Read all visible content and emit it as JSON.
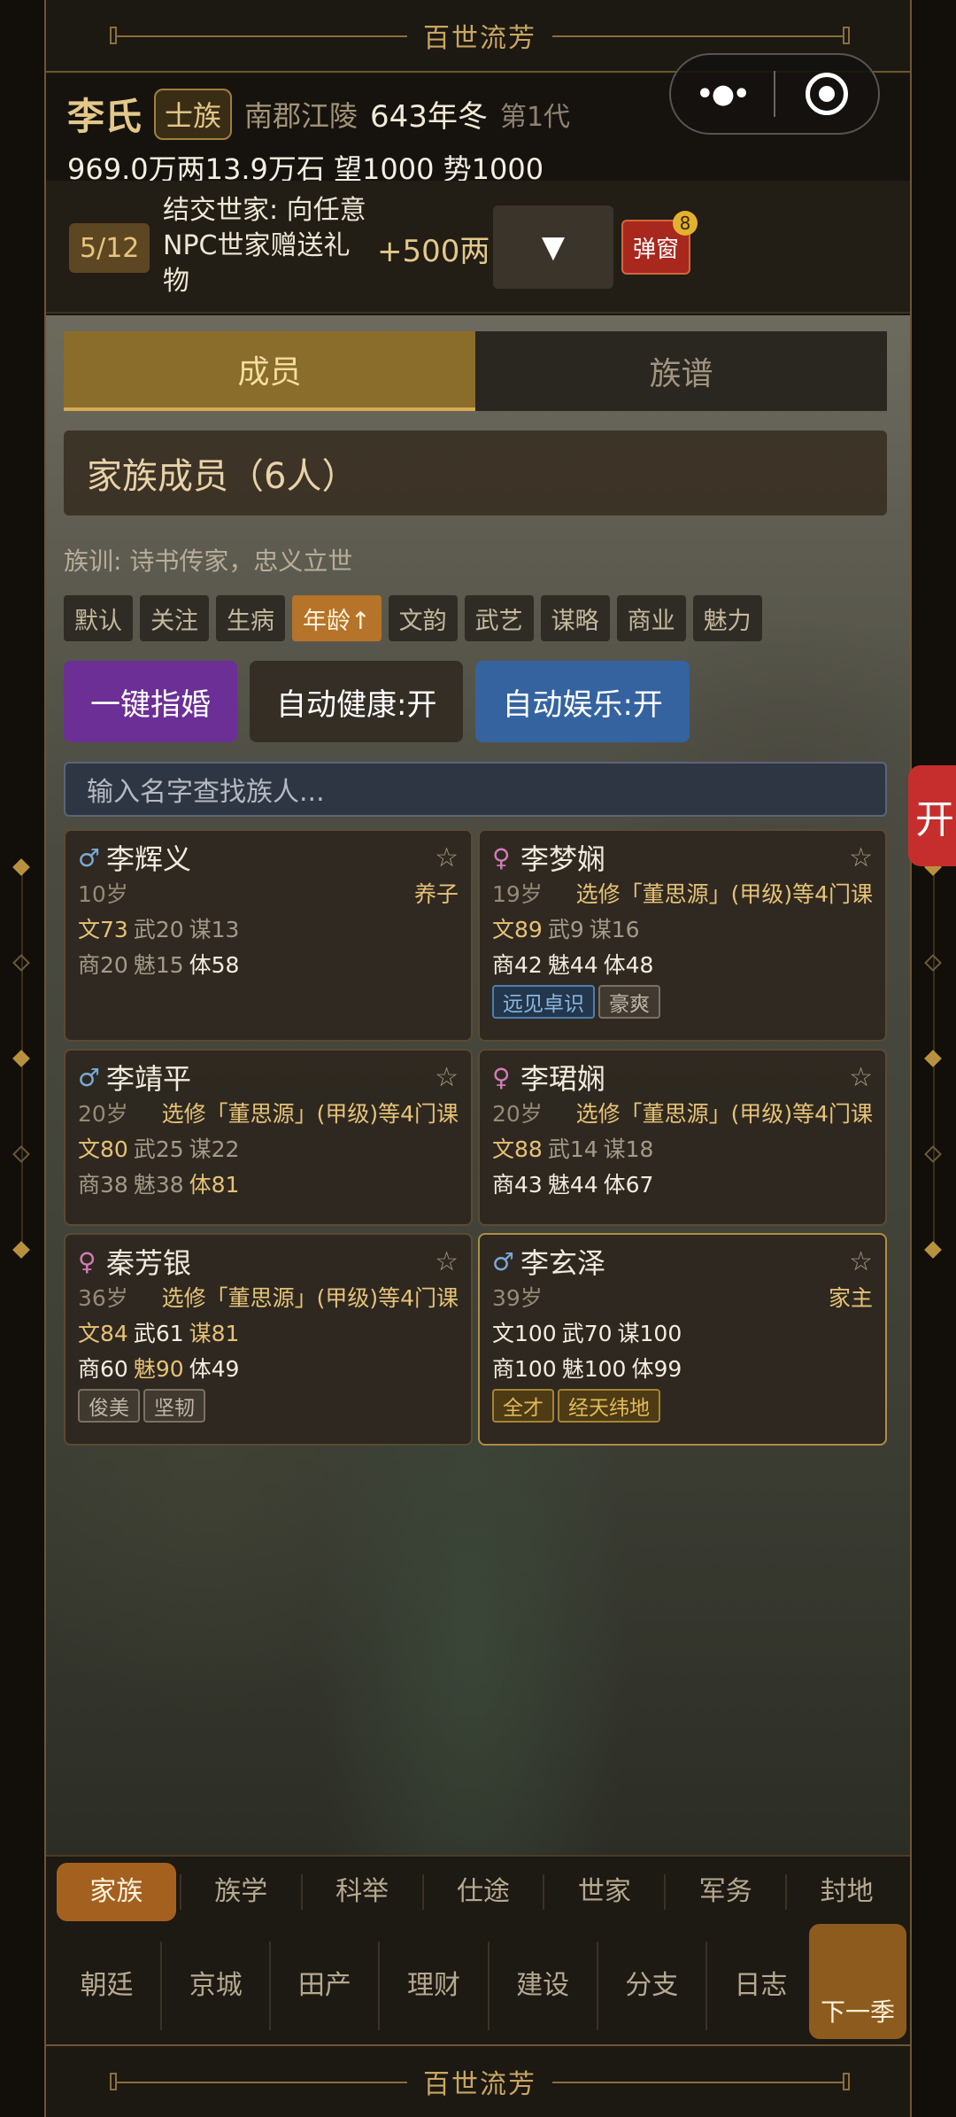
{
  "banner": {
    "title": "百世流芳"
  },
  "header": {
    "family": "李氏",
    "rank": "士族",
    "place": "南郡江陵",
    "year": "643年冬",
    "generation": "第1代",
    "stats": "969.0万两13.9万石  望1000 势1000"
  },
  "capsule": {
    "menu_icon": "more-dots-icon",
    "close_icon": "target-icon"
  },
  "task": {
    "progress": "5/12",
    "desc": "结交世家: 向任意NPC世家赠送礼物",
    "reward": "+500两",
    "dropdown": "▼",
    "popup_label": "弹窗",
    "popup_badge": "8"
  },
  "tabs": [
    {
      "label": "成员"
    },
    {
      "label": "族谱"
    }
  ],
  "section": {
    "title": "家族成员（6人）",
    "motto": "族训: 诗书传家，忠义立世"
  },
  "sorts": [
    "默认",
    "关注",
    "生病",
    "年龄↑",
    "文韵",
    "武艺",
    "谋略",
    "商业",
    "魅力"
  ],
  "actions": [
    "一键指婚",
    "自动健康:开",
    "自动娱乐:开"
  ],
  "search": {
    "placeholder": "输入名字查找族人..."
  },
  "members": [
    {
      "sex": "♂",
      "name": "李辉义",
      "star": "☆",
      "age": "10岁",
      "note": "养子",
      "wen": "文73",
      "wu": "武20",
      "mou": "谋13",
      "shang": "商20",
      "mei": "魅15",
      "ti": "体58",
      "traits": []
    },
    {
      "sex": "♀",
      "name": "李梦娴",
      "star": "☆",
      "age": "19岁",
      "note": "选修「董思源」(甲级)等4门课",
      "wen": "文89",
      "wu": "武9",
      "mou": "谋16",
      "shang": "商42",
      "mei": "魅44",
      "ti": "体48",
      "traits": [
        "远见卓识",
        "豪爽"
      ]
    },
    {
      "sex": "♂",
      "name": "李靖平",
      "star": "☆",
      "age": "20岁",
      "note": "选修「董思源」(甲级)等4门课",
      "wen": "文80",
      "wu": "武25",
      "mou": "谋22",
      "shang": "商38",
      "mei": "魅38",
      "ti": "体81",
      "traits": []
    },
    {
      "sex": "♀",
      "name": "李珺娴",
      "star": "☆",
      "age": "20岁",
      "note": "选修「董思源」(甲级)等4门课",
      "wen": "文88",
      "wu": "武14",
      "mou": "谋18",
      "shang": "商43",
      "mei": "魅44",
      "ti": "体67",
      "traits": []
    },
    {
      "sex": "♀",
      "name": "秦芳银",
      "star": "☆",
      "age": "36岁",
      "note": "选修「董思源」(甲级)等4门课",
      "wen": "文84",
      "wu": "武61",
      "mou": "谋81",
      "shang": "商60",
      "mei": "魅90",
      "ti": "体49",
      "traits": [
        "俊美",
        "坚韧"
      ]
    },
    {
      "sex": "♂",
      "name": "李玄泽",
      "star": "☆",
      "age": "39岁",
      "note": "家主",
      "wen": "文100",
      "wu": "武70",
      "mou": "谋100",
      "shang": "商100",
      "mei": "魅100",
      "ti": "体99",
      "traits": [
        "全才",
        "经天纬地"
      ]
    }
  ],
  "nav": {
    "row1": [
      "家族",
      "族学",
      "科举",
      "仕途",
      "世家",
      "军务",
      "封地"
    ],
    "row2": [
      "朝廷",
      "京城",
      "田产",
      "理财",
      "建设",
      "分支",
      "日志"
    ],
    "next": "下一季"
  },
  "float_button": "开"
}
